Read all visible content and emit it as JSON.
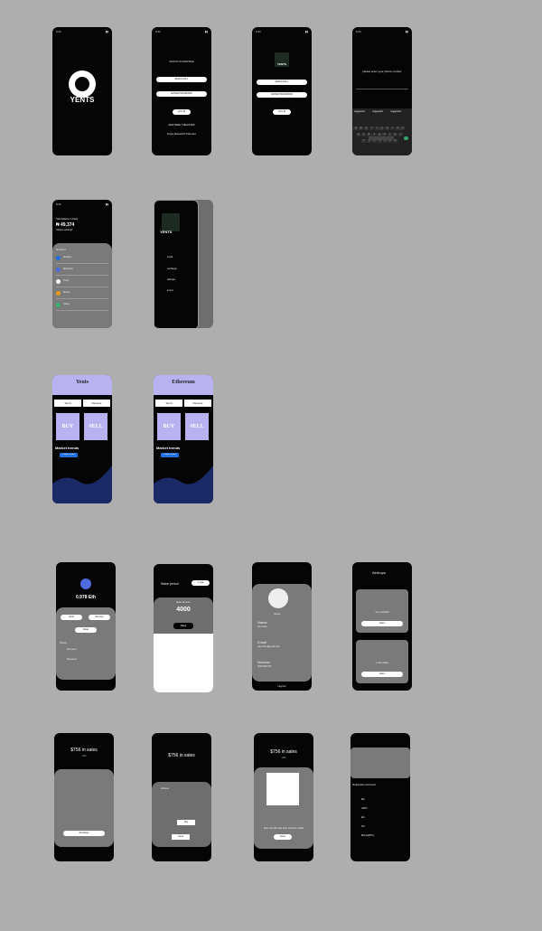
{
  "app": {
    "brand": "YENTS",
    "brand_yents": "Yents",
    "brand_ethereum": "Ethereum"
  },
  "colors": {
    "background": "#aeaeae",
    "phone": "#050505",
    "panel": "#7a7a7a",
    "accent_lavender": "#b9b2f0",
    "accent_blue": "#1f6fe0"
  },
  "signin": {
    "title": "SIGN IN TO CONTINUE",
    "field1": "EMAIL/CALL",
    "field2": "ENTER PASSWORD",
    "button": "LOG IN",
    "new_here": "NEW HERE ? REGISTER",
    "forgot": "Forgot Password? Click here"
  },
  "phone_entry": {
    "prompt": "please enter your phone number",
    "suggestions": [
      "suggestion",
      "suggestion",
      "suggestion"
    ]
  },
  "keyboard": {
    "row1": [
      "q",
      "w",
      "e",
      "r",
      "t",
      "y",
      "u",
      "i",
      "o",
      "p"
    ],
    "row2": [
      "a",
      "s",
      "d",
      "f",
      "g",
      "h",
      "j",
      "k",
      "l"
    ],
    "row3": [
      "z",
      "x",
      "c",
      "v",
      "b",
      "n",
      "m"
    ]
  },
  "wallet": {
    "label": "Total balance in Naira",
    "balance": "₦ 49,374",
    "sub": "Todays earnings",
    "section": "All tokens",
    "tokens": [
      {
        "name": "Airdrops",
        "icon": "coin-icon",
        "color": "#1f6fe0"
      },
      {
        "name": "Ethereum",
        "icon": "ethereum-icon",
        "color": "#4f6bde"
      },
      {
        "name": "Yents",
        "icon": "yents-icon",
        "color": "#ffffff"
      },
      {
        "name": "Bitcoin",
        "icon": "bitcoin-icon",
        "color": "#f19a1a"
      },
      {
        "name": "Tether",
        "icon": "tether-icon",
        "color": "#33b36f"
      }
    ]
  },
  "menu": {
    "items": [
      {
        "label": "credit",
        "icon": "credit-icon"
      },
      {
        "label": "exchange",
        "icon": "exchange-icon"
      },
      {
        "label": "airdrops",
        "icon": "airdrop-icon"
      },
      {
        "label": "invest",
        "icon": "invest-icon"
      }
    ]
  },
  "market": {
    "tab1": "Send",
    "tab2": "Receive",
    "buy": "BUY",
    "sell": "SELL",
    "trends": "Market trends",
    "badge": "Today's market"
  },
  "eth_balance": {
    "amount": "0.978 Eth",
    "btn1": "Send",
    "btn2": "Receive",
    "btn3": "Swap",
    "history": "History",
    "entries": [
      "Received",
      "Received"
    ]
  },
  "stake": {
    "title": "Stake period",
    "period": "1 year",
    "label": "Enter Amount",
    "amount": "4000",
    "button": "Save",
    "keys": [
      "1",
      "2",
      "3",
      "4",
      "5",
      "6",
      "7",
      "8",
      "9",
      ".",
      "0",
      "→"
    ]
  },
  "profile": {
    "picture": "picture",
    "name_label": "Name",
    "name": "Jane Doe",
    "email_label": "Email",
    "email": "Jane.Doe@gmail.com",
    "number_label": "Number",
    "number": "09167007970",
    "logout": "Log Out"
  },
  "airdrops": {
    "title": "Airdrops",
    "card1": "One Golf Ball",
    "card2": "2 cole dollars",
    "claim": "Claim"
  },
  "sales": {
    "amount": "$756 in sales",
    "change": "+4%",
    "recharge": "Recharge",
    "pay": "Pay",
    "send": "Send",
    "scan_text": "Scan the QR code from vendor's mobile",
    "done": "Done",
    "address_label": "Address"
  },
  "exchange_list": {
    "title": "Simple Earn and Invest",
    "coins": [
      "Eth",
      "USDT",
      "Eth",
      "Sol",
      "Bitcoin(BTC)"
    ]
  }
}
